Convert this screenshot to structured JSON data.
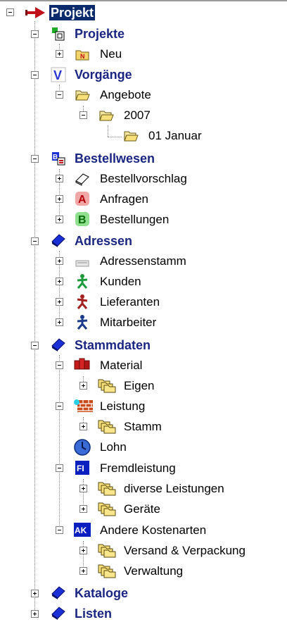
{
  "tree": {
    "root": {
      "label": "Projekt",
      "icon": "red-arrow-icon"
    },
    "projekte": {
      "label": "Projekte",
      "icon": "projects-icon",
      "children": [
        {
          "label": "Neu",
          "icon": "new-folder-icon"
        }
      ]
    },
    "vorgaenge": {
      "label": "Vorgänge",
      "icon": "v-icon",
      "angebote": {
        "label": "Angebote",
        "icon": "open-folder-icon",
        "year": {
          "label": "2007",
          "icon": "open-folder-icon",
          "month": {
            "label": "01 Januar",
            "icon": "open-folder-icon"
          }
        }
      }
    },
    "bestellwesen": {
      "label": "Bestellwesen",
      "icon": "order-icon",
      "children": [
        {
          "label": "Bestellvorschlag",
          "icon": "book-outline-icon"
        },
        {
          "label": "Anfragen",
          "icon": "a-badge-icon"
        },
        {
          "label": "Bestellungen",
          "icon": "b-badge-icon"
        }
      ]
    },
    "adressen": {
      "label": "Adressen",
      "icon": "blue-book-icon",
      "children": [
        {
          "label": "Adressenstamm",
          "icon": "address-card-icon"
        },
        {
          "label": "Kunden",
          "icon": "person-green-icon"
        },
        {
          "label": "Lieferanten",
          "icon": "person-red-icon"
        },
        {
          "label": "Mitarbeiter",
          "icon": "person-blue-icon"
        }
      ]
    },
    "stammdaten": {
      "label": "Stammdaten",
      "icon": "blue-book-icon",
      "material": {
        "label": "Material",
        "icon": "material-icon",
        "children": [
          {
            "label": "Eigen",
            "icon": "folder-stack-icon"
          }
        ]
      },
      "leistung": {
        "label": "Leistung",
        "icon": "brick-wall-icon",
        "children": [
          {
            "label": "Stamm",
            "icon": "folder-stack-icon"
          }
        ]
      },
      "lohn": {
        "label": "Lohn",
        "icon": "clock-icon"
      },
      "fremdleistung": {
        "label": "Fremdleistung",
        "icon": "fl-badge-icon",
        "children": [
          {
            "label": "diverse Leistungen",
            "icon": "folder-stack-icon"
          },
          {
            "label": "Geräte",
            "icon": "folder-stack-icon"
          }
        ]
      },
      "andere": {
        "label": "Andere Kostenarten",
        "icon": "ak-badge-icon",
        "children": [
          {
            "label": "Versand & Verpackung",
            "icon": "folder-stack-icon"
          },
          {
            "label": "Verwaltung",
            "icon": "folder-stack-icon"
          }
        ]
      }
    },
    "kataloge": {
      "label": "Kataloge",
      "icon": "blue-book-icon"
    },
    "listen": {
      "label": "Listen",
      "icon": "blue-book-icon"
    }
  },
  "badges": {
    "fl": "FI",
    "ak": "AK",
    "a": "A",
    "b": "B",
    "n": "N",
    "v": "V"
  },
  "colors": {
    "accent": "#1b2683",
    "selection": "#0a2a6b",
    "icon_blue": "#1a2fd6"
  }
}
